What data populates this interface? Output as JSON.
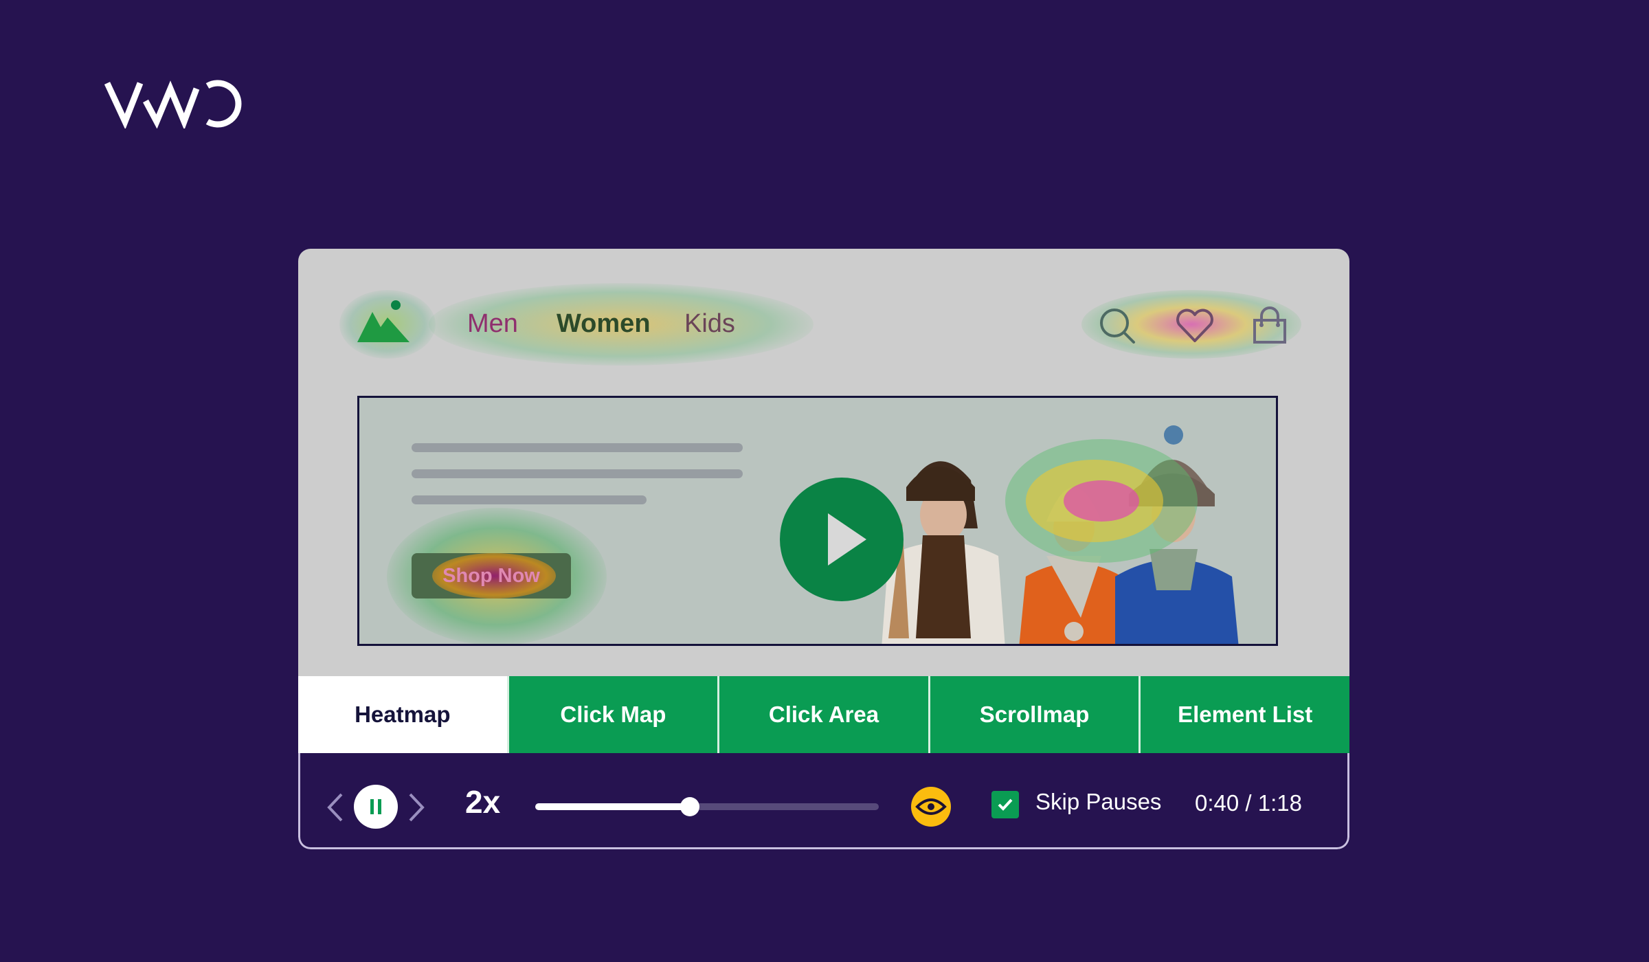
{
  "brand": {
    "name": "VWO"
  },
  "site": {
    "nav": [
      {
        "label": "Men"
      },
      {
        "label": "Women"
      },
      {
        "label": "Kids"
      }
    ],
    "header_icons": [
      "search-icon",
      "heart-icon",
      "shopping-bag-icon"
    ],
    "banner": {
      "cta_label": "Shop Now",
      "placeholder_lines": 3,
      "media": "play-icon"
    }
  },
  "tabs": [
    {
      "label": "Heatmap",
      "active": true
    },
    {
      "label": "Click Map",
      "active": false
    },
    {
      "label": "Click Area",
      "active": false
    },
    {
      "label": "Scrollmap",
      "active": false
    },
    {
      "label": "Element List",
      "active": false
    }
  ],
  "player": {
    "speed": "2x",
    "state": "playing",
    "progress_fraction": 0.45,
    "skip_pauses": {
      "label": "Skip Pauses",
      "checked": true
    },
    "time": "0:40 / 1:18",
    "current": "0:40",
    "total": "1:18"
  },
  "colors": {
    "background": "#261350",
    "accent_green": "#0a9c53",
    "eye_yellow": "#fbbc0f",
    "active_tab_text": "#15133a"
  }
}
